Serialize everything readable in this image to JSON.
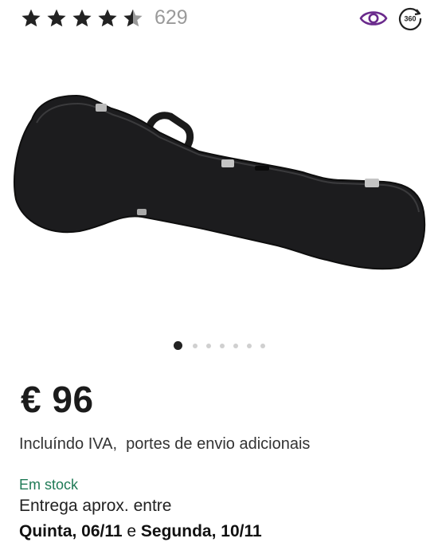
{
  "rating": {
    "stars_value": 4.5,
    "stars_max": 5,
    "count": "629"
  },
  "toolbar": {
    "eye_icon": "eye-icon",
    "view_360_label": "360"
  },
  "gallery": {
    "image_alt": "guitar-case",
    "total_images": 7,
    "current_index": 1
  },
  "price": {
    "amount": "€ 96"
  },
  "tax_note": "Incluíndo IVA,  portes de envio adicionais",
  "availability": {
    "status": "Em stock",
    "status_color": "#1f7a56",
    "delivery_label": "Entrega aprox. entre",
    "date_from": "Quinta, 06/11",
    "connector": " e ",
    "date_to": "Segunda, 10/11"
  },
  "colors": {
    "accent_purple": "#6a2a8c",
    "star_color": "#222222"
  }
}
